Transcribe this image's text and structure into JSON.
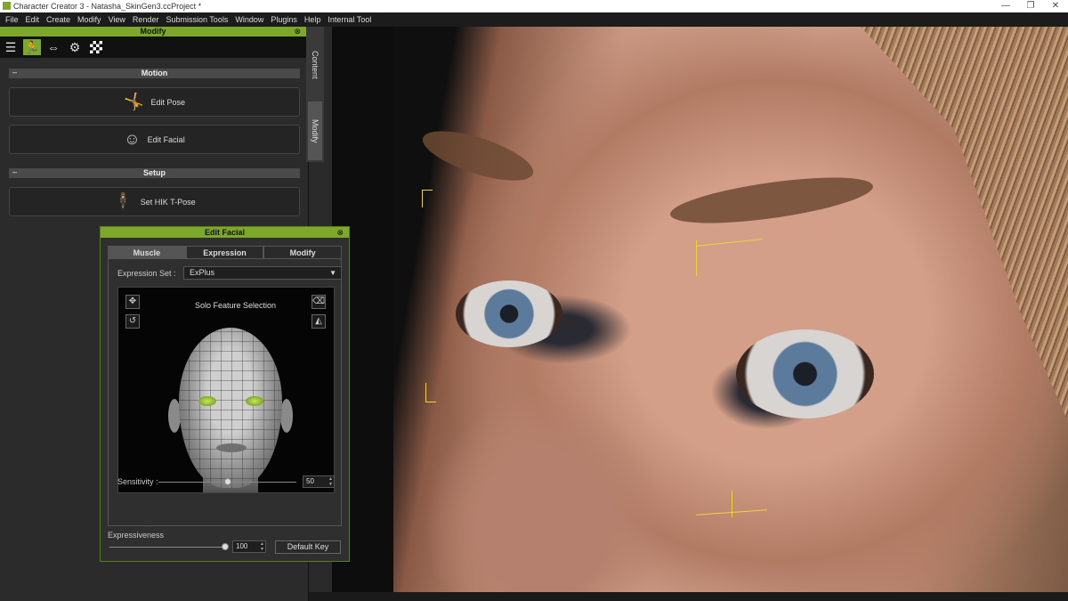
{
  "window": {
    "title": "Character Creator 3 - Natasha_SkinGen3.ccProject *",
    "minimize": "—",
    "maximize": "❐",
    "close": "✕"
  },
  "menu": [
    "File",
    "Edit",
    "Create",
    "Modify",
    "View",
    "Render",
    "Submission Tools",
    "Window",
    "Plugins",
    "Help",
    "Internal Tool"
  ],
  "modify_panel": {
    "title": "Modify",
    "side_tabs": [
      "Content",
      "Modify"
    ],
    "sections": {
      "motion": "Motion",
      "setup": "Setup"
    },
    "buttons": {
      "edit_pose": "Edit Pose",
      "edit_facial": "Edit Facial",
      "set_hik": "Set HIK T-Pose"
    }
  },
  "edit_facial": {
    "title": "Edit Facial",
    "tabs": [
      "Muscle",
      "Expression",
      "Modify"
    ],
    "active_tab": "Muscle",
    "expression_set_label": "Expression Set :",
    "expression_set_value": "ExPlus",
    "solo_label": "Solo Feature Selection",
    "sensitivity_label": "Sensitivity :",
    "sensitivity_value": "50",
    "sensitivity_level": 0.5,
    "expressiveness_label": "Expressiveness",
    "expressiveness_value": "100",
    "expressiveness_level": 1.0,
    "default_key": "Default Key"
  },
  "colors": {
    "accent": "#7ea82a",
    "marker": "#f2d23b"
  }
}
